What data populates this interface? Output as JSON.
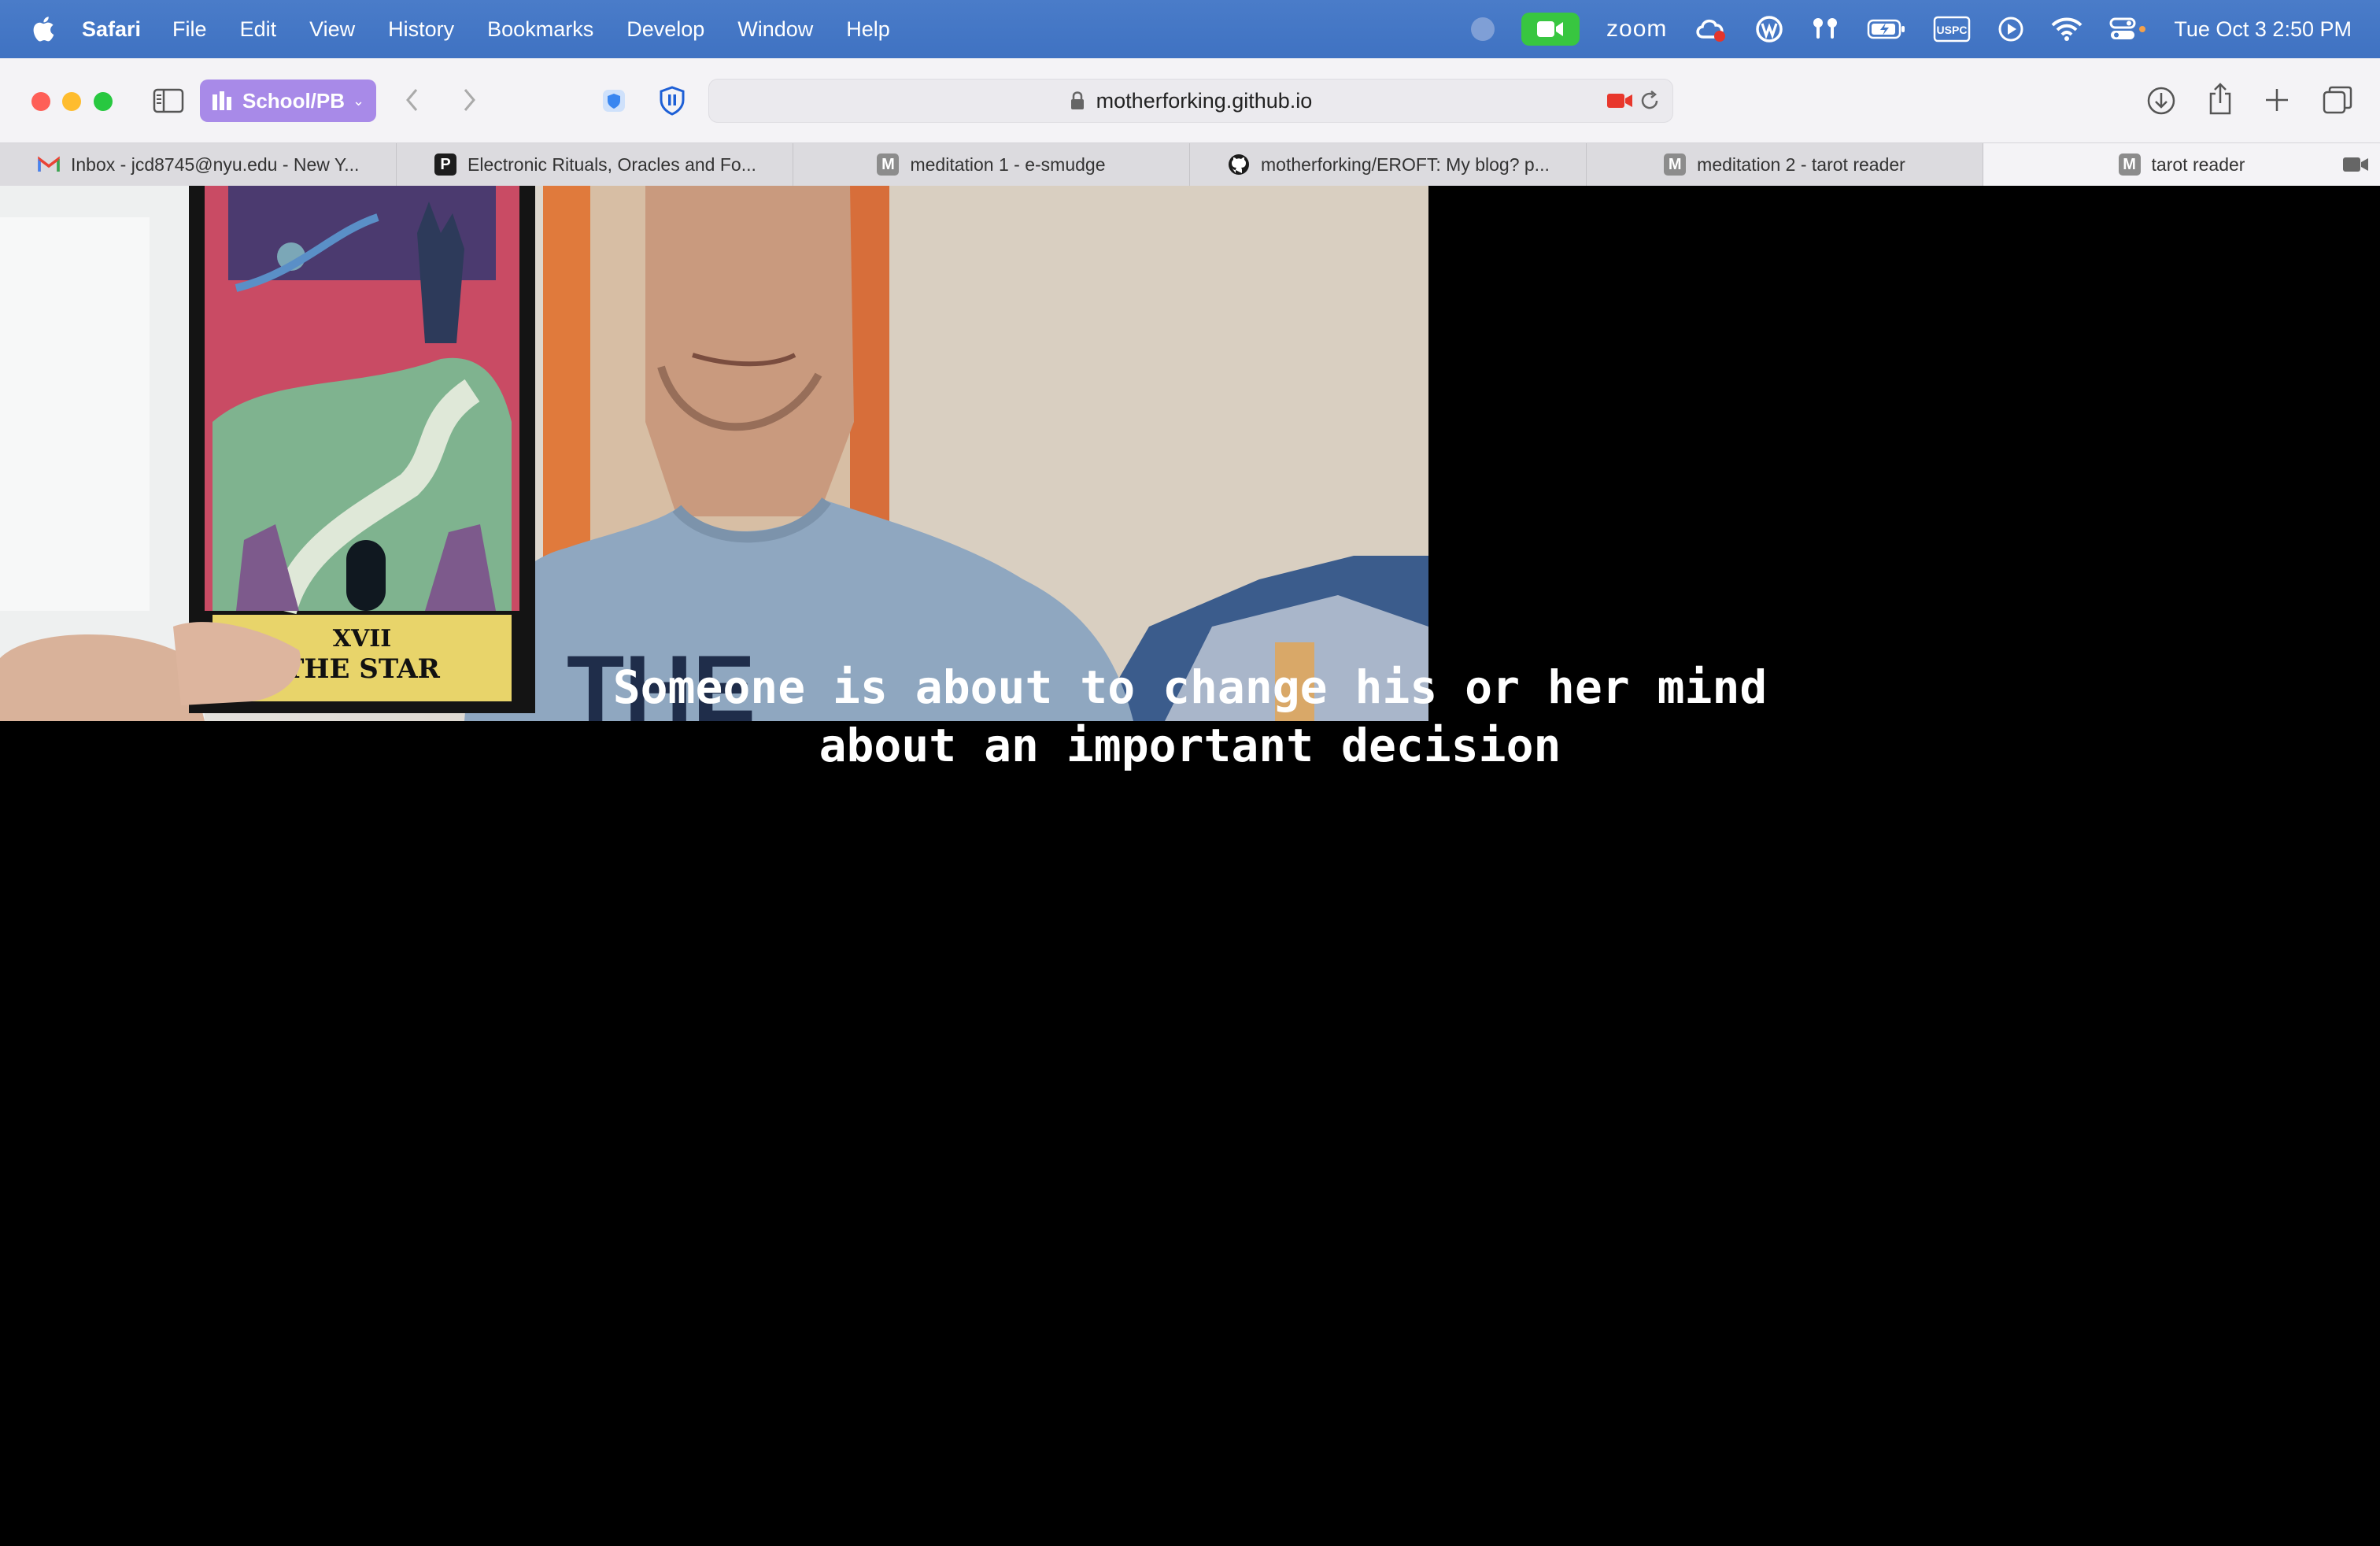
{
  "menubar": {
    "app_name": "Safari",
    "items": [
      "File",
      "Edit",
      "View",
      "History",
      "Bookmarks",
      "Develop",
      "Window",
      "Help"
    ],
    "zoom_label": "zoom",
    "clock": "Tue Oct 3  2:50 PM",
    "status_icons": [
      "recording-dot-icon",
      "facetime-icon",
      "zoom-icon",
      "creative-cloud-icon",
      "wordpress-icon",
      "airpods-icon",
      "battery-icon",
      "uspc-icon",
      "play-icon",
      "wifi-icon",
      "control-center-icon"
    ],
    "uspc_text": "USPC"
  },
  "toolbar": {
    "tab_group_label": "School/PB",
    "address": "motherforking.github.io",
    "colors": {
      "tab_group": "#a88ae8",
      "menubar": "#4177c6"
    }
  },
  "tabs": [
    {
      "title": "Inbox - jcd8745@nyu.edu - New Y...",
      "icon": "gmail-icon"
    },
    {
      "title": "Electronic Rituals, Oracles and Fo...",
      "icon": "p-icon",
      "icon_text": "P"
    },
    {
      "title": "meditation 1 - e-smudge",
      "icon": "m-icon",
      "icon_text": "M"
    },
    {
      "title": "motherforking/EROFT: My blog? p...",
      "icon": "github-icon"
    },
    {
      "title": "meditation 2 - tarot reader",
      "icon": "m-icon",
      "icon_text": "M"
    },
    {
      "title": "tarot reader",
      "icon": "m-icon",
      "icon_text": "M",
      "active": true
    }
  ],
  "page": {
    "card_numeral": "XVII",
    "card_name": "THE STAR",
    "shirt_text": "THE",
    "caption_line1": "Someone is about to change his or her mind",
    "caption_line2": "about an important decision"
  }
}
